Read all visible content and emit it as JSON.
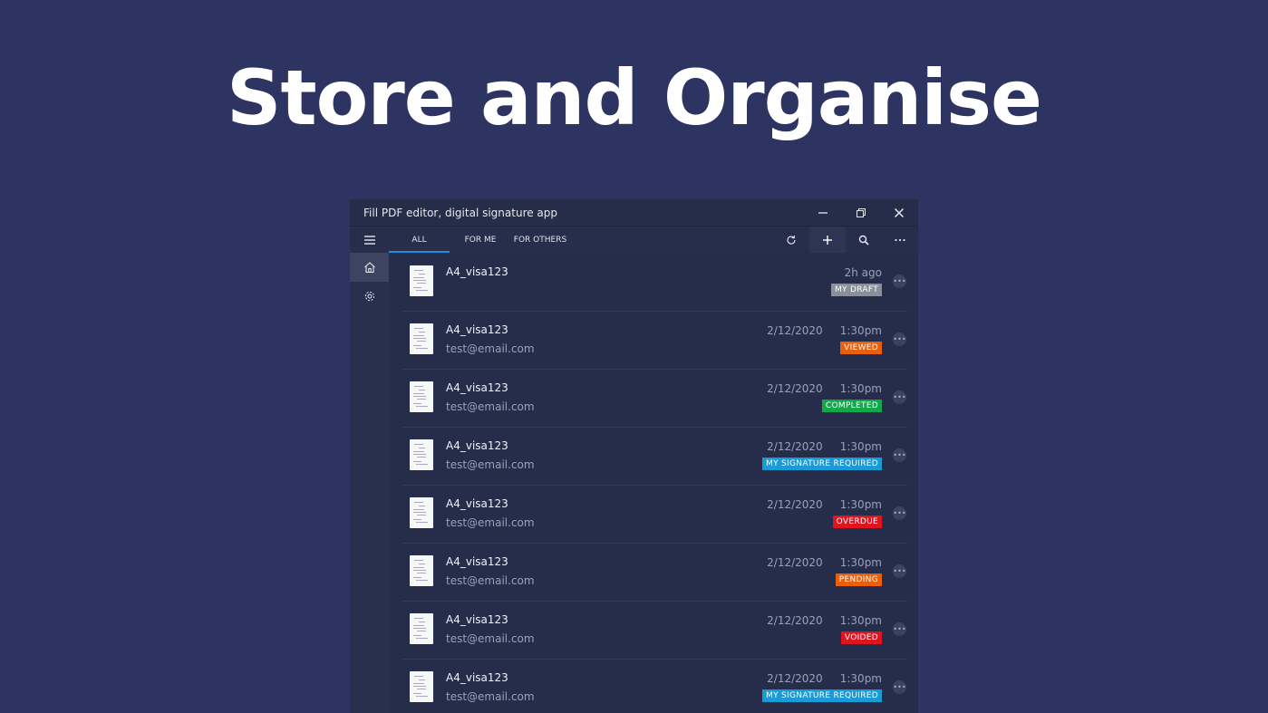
{
  "headline": "Store and Organise",
  "window": {
    "title": "Fill PDF editor, digital signature app",
    "minimize_icon": "minimize-icon",
    "restore_icon": "restore-icon",
    "close_icon": "close-icon"
  },
  "toolbar": {
    "tabs": [
      {
        "label": "ALL",
        "active": true
      },
      {
        "label": "FOR ME",
        "active": false
      },
      {
        "label": "FOR OTHERS",
        "active": false
      }
    ]
  },
  "colors": {
    "accent": "#1b8fe0",
    "draft": "#8a8f99",
    "viewed": "#e8600c",
    "completed": "#12a84a",
    "signature": "#1a9ad6",
    "overdue": "#e0141e",
    "pending": "#e8600c",
    "voided": "#e0141e"
  },
  "documents": [
    {
      "name": "A4_visa123",
      "email": "",
      "time": "2h ago",
      "status": "MY DRAFT",
      "color": "#8a8f99"
    },
    {
      "name": "A4_visa123",
      "email": "test@email.com",
      "time": "2/12/2020     1:30pm",
      "status": "VIEWED",
      "color": "#e8600c"
    },
    {
      "name": "A4_visa123",
      "email": "test@email.com",
      "time": "2/12/2020     1:30pm",
      "status": "COMPLETED",
      "color": "#12a84a"
    },
    {
      "name": "A4_visa123",
      "email": "test@email.com",
      "time": "2/12/2020     1:30pm",
      "status": "MY SIGNATURE REQUIRED",
      "color": "#1a9ad6"
    },
    {
      "name": "A4_visa123",
      "email": "test@email.com",
      "time": "2/12/2020     1:30pm",
      "status": "OVERDUE",
      "color": "#e0141e"
    },
    {
      "name": "A4_visa123",
      "email": "test@email.com",
      "time": "2/12/2020     1:30pm",
      "status": "PENDING",
      "color": "#e8600c"
    },
    {
      "name": "A4_visa123",
      "email": "test@email.com",
      "time": "2/12/2020     1:30pm",
      "status": "VOIDED",
      "color": "#e0141e"
    },
    {
      "name": "A4_visa123",
      "email": "test@email.com",
      "time": "2/12/2020     1:30pm",
      "status": "MY SIGNATURE REQUIRED",
      "color": "#1a9ad6"
    }
  ]
}
